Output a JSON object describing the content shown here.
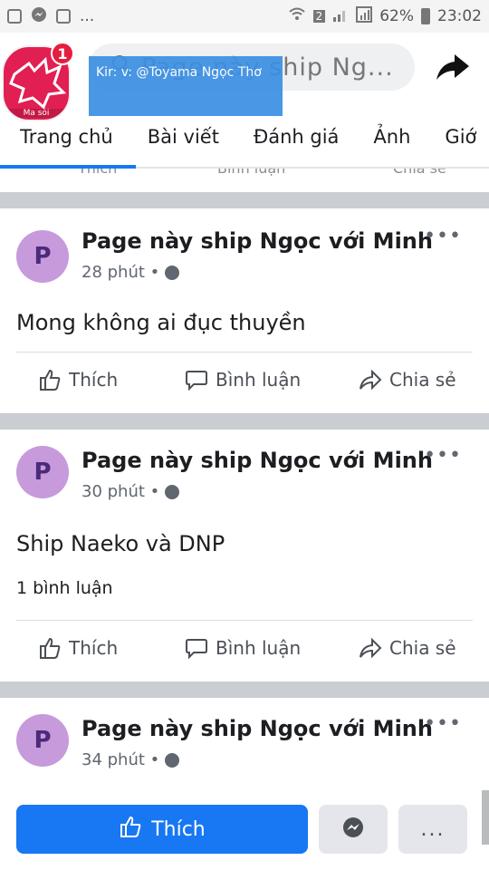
{
  "status_bar": {
    "time": "23:02",
    "battery": "62%",
    "sim_badge": "2",
    "more": "..."
  },
  "header": {
    "badge_count": "1",
    "avatar_caption": "Ma sói",
    "search_text": "Page này ship Ng...",
    "tooltip_text": "Kir: v: @Toyama Ngọc Thơ"
  },
  "tabs": [
    {
      "label": "Trang chủ",
      "active": true
    },
    {
      "label": "Bài viết",
      "active": false
    },
    {
      "label": "Đánh giá",
      "active": false
    },
    {
      "label": "Ảnh",
      "active": false
    },
    {
      "label": "Giớ",
      "active": false
    }
  ],
  "ghost_actions": {
    "like": "Thích",
    "comment": "Bình luận",
    "share": "Chia sẻ"
  },
  "posts": [
    {
      "avatar_letter": "P",
      "name": "Page này ship Ngọc với Minh",
      "time": "28 phút •",
      "text": "Mong không ai đục thuyền",
      "comments": ""
    },
    {
      "avatar_letter": "P",
      "name": "Page này ship Ngọc với Minh",
      "time": "30 phút •",
      "text": "Ship Naeko và DNP",
      "comments": "1 bình luận"
    },
    {
      "avatar_letter": "P",
      "name": "Page này ship Ngọc với Minh",
      "time": "34 phút •",
      "text": "",
      "comments": ""
    }
  ],
  "post_actions": {
    "like": "Thích",
    "comment": "Bình luận",
    "share": "Chia sẻ"
  },
  "bottom_bar": {
    "like_label": "Thích",
    "more_label": "..."
  },
  "colors": {
    "accent": "#1877f2",
    "badge": "#e41e3f",
    "avatar": "#c69adb",
    "tooltip": "#3b8fe3",
    "separator": "#cacdd1"
  }
}
